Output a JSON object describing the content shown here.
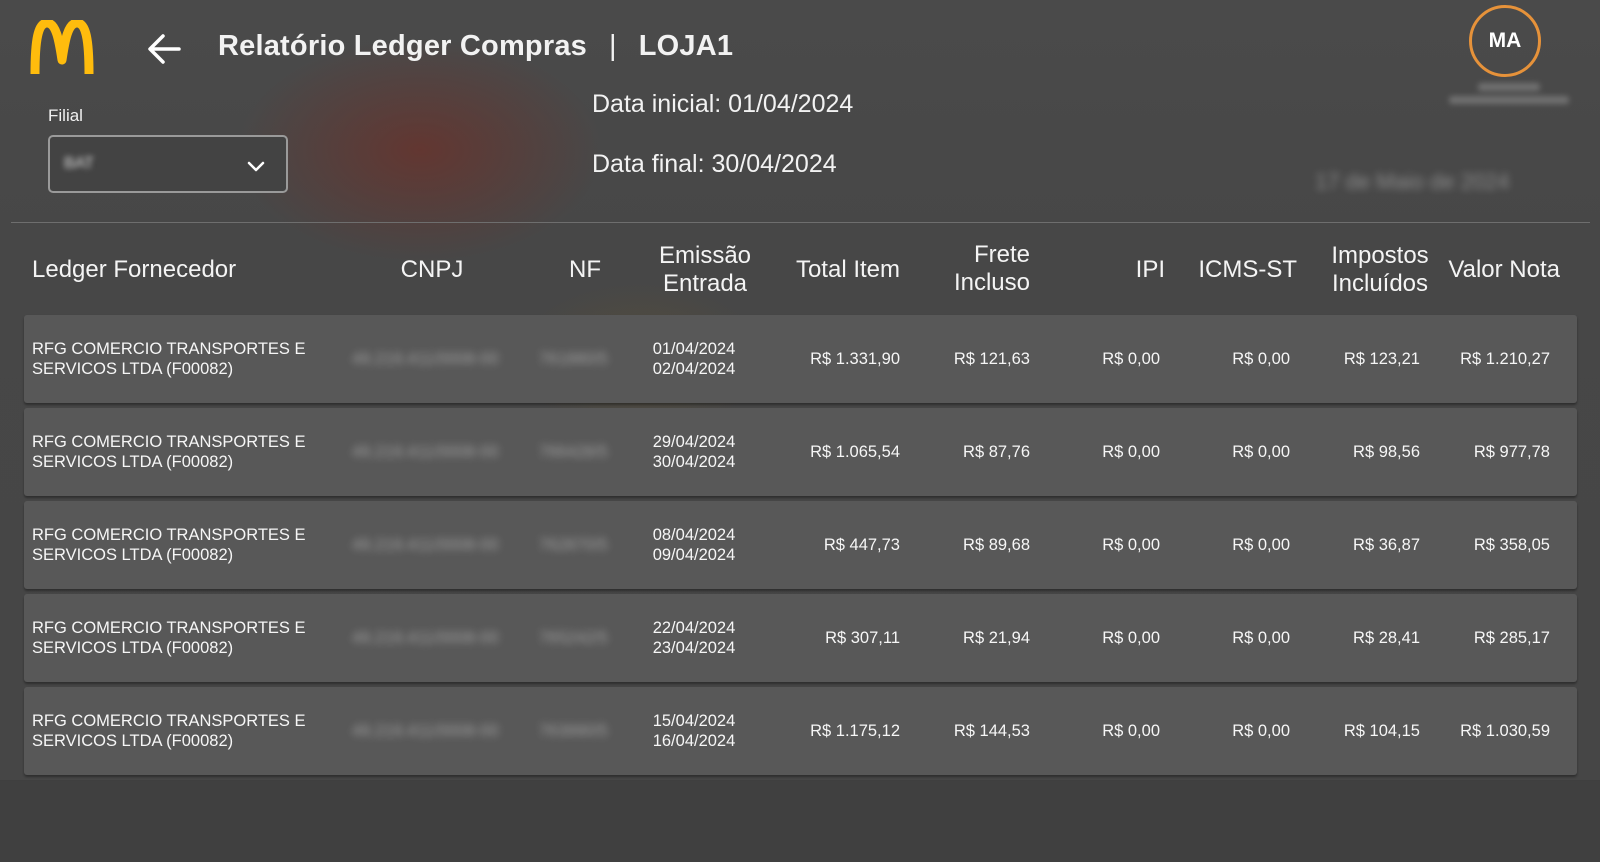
{
  "header": {
    "brand": "McDonald's",
    "title": "Relatório Ledger Compras",
    "separator": "|",
    "store": "LOJA1",
    "user_initials": "MA",
    "user_name": "xl.5-5-99",
    "user_timestamp": "17/06/2024 - 15:45",
    "current_date": "17 de Maio de 2024"
  },
  "filters": {
    "filial_label": "Filial",
    "filial_value": "BAT",
    "date_start": "Data inicial: 01/04/2024",
    "date_end": "Data final: 30/04/2024"
  },
  "table": {
    "columns": {
      "fornecedor": "Ledger Fornecedor",
      "cnpj": "CNPJ",
      "nf": "NF",
      "emissao_1": "Emissão",
      "emissao_2": "Entrada",
      "total_item": "Total Item",
      "frete_1": "Frete",
      "frete_2": "Incluso",
      "ipi": "IPI",
      "icms_st": "ICMS-ST",
      "impostos_1": "Impostos",
      "impostos_2": "Incluídos",
      "valor_nota": "Valor Nota"
    },
    "rows": [
      {
        "fornecedor_1": "RFG COMERCIO TRANSPORTES E",
        "fornecedor_2": "SERVICOS LTDA (F00082)",
        "cnpj": "49.219.411/0008-00",
        "nf": "761880/5",
        "emissao": "01/04/2024",
        "entrada": "02/04/2024",
        "total_item": "R$ 1.331,90",
        "frete": "R$ 121,63",
        "ipi": "R$ 0,00",
        "icms_st": "R$ 0,00",
        "impostos": "R$ 123,21",
        "valor_nota": "R$ 1.210,27"
      },
      {
        "fornecedor_1": "RFG COMERCIO TRANSPORTES E",
        "fornecedor_2": "SERVICOS LTDA (F00082)",
        "cnpj": "49.219.411/0008-00",
        "nf": "766428/5",
        "emissao": "29/04/2024",
        "entrada": "30/04/2024",
        "total_item": "R$ 1.065,54",
        "frete": "R$ 87,76",
        "ipi": "R$ 0,00",
        "icms_st": "R$ 0,00",
        "impostos": "R$ 98,56",
        "valor_nota": "R$ 977,78"
      },
      {
        "fornecedor_1": "RFG COMERCIO TRANSPORTES E",
        "fornecedor_2": "SERVICOS LTDA (F00082)",
        "cnpj": "49.219.411/0008-00",
        "nf": "762870/5",
        "emissao": "08/04/2024",
        "entrada": "09/04/2024",
        "total_item": "R$ 447,73",
        "frete": "R$ 89,68",
        "ipi": "R$ 0,00",
        "icms_st": "R$ 0,00",
        "impostos": "R$ 36,87",
        "valor_nota": "R$ 358,05"
      },
      {
        "fornecedor_1": "RFG COMERCIO TRANSPORTES E",
        "fornecedor_2": "SERVICOS LTDA (F00082)",
        "cnpj": "49.219.411/0008-00",
        "nf": "765242/5",
        "emissao": "22/04/2024",
        "entrada": "23/04/2024",
        "total_item": "R$ 307,11",
        "frete": "R$ 21,94",
        "ipi": "R$ 0,00",
        "icms_st": "R$ 0,00",
        "impostos": "R$ 28,41",
        "valor_nota": "R$ 285,17"
      },
      {
        "fornecedor_1": "RFG COMERCIO TRANSPORTES E",
        "fornecedor_2": "SERVICOS LTDA (F00082)",
        "cnpj": "49.219.411/0008-00",
        "nf": "763990/5",
        "emissao": "15/04/2024",
        "entrada": "16/04/2024",
        "total_item": "R$ 1.175,12",
        "frete": "R$ 144,53",
        "ipi": "R$ 0,00",
        "icms_st": "R$ 0,00",
        "impostos": "R$ 104,15",
        "valor_nota": "R$ 1.030,59"
      }
    ]
  },
  "colors": {
    "background": "#3f3f3f",
    "row_background": "#585858",
    "logo_yellow": "#ffbc0d",
    "avatar_ring": "#e6923a"
  },
  "icons": {
    "logo": "golden-arches-logo",
    "back": "arrow-left-icon",
    "dropdown": "chevron-down-icon"
  }
}
